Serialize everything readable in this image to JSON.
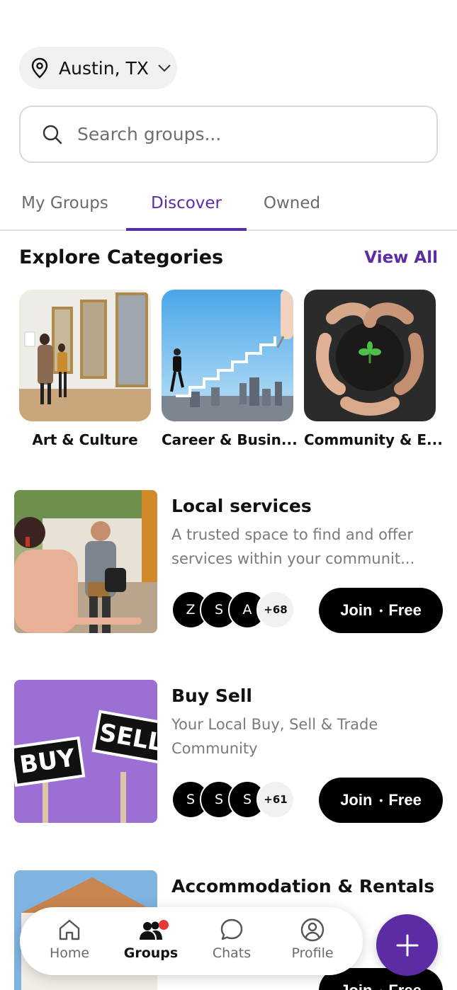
{
  "location": {
    "label": "Austin, TX",
    "icon": "map-pin-icon"
  },
  "search": {
    "placeholder": "Search groups..."
  },
  "tabs": [
    {
      "label": "My Groups",
      "active": false
    },
    {
      "label": "Discover",
      "active": true
    },
    {
      "label": "Owned",
      "active": false
    }
  ],
  "categories_section": {
    "title": "Explore Categories",
    "view_all": "View All",
    "items": [
      {
        "label": "Art & Culture"
      },
      {
        "label": "Career & Busin..."
      },
      {
        "label": "Community & E..."
      }
    ]
  },
  "groups": [
    {
      "title": "Local services",
      "description": "A trusted space to find and offer services within your communit...",
      "members": [
        "Z",
        "S",
        "A"
      ],
      "more": "+68",
      "join_label": "Join",
      "price": "Free"
    },
    {
      "title": "Buy Sell",
      "description": "Your Local Buy, Sell & Trade Community",
      "members": [
        "S",
        "S",
        "S"
      ],
      "more": "+61",
      "join_label": "Join",
      "price": "Free",
      "image_sign_texts": [
        "BUY",
        "SELL"
      ]
    },
    {
      "title": "Accommodation & Rentals",
      "description": "",
      "members": [],
      "more": "",
      "join_label": "Join",
      "price": "Free"
    }
  ],
  "bottom_nav": [
    {
      "label": "Home",
      "icon": "home-icon",
      "active": false
    },
    {
      "label": "Groups",
      "icon": "groups-icon",
      "active": true,
      "badge": true
    },
    {
      "label": "Chats",
      "icon": "chat-bubble-icon",
      "active": false
    },
    {
      "label": "Profile",
      "icon": "profile-icon",
      "active": false
    }
  ],
  "colors": {
    "accent": "#5b2ca3",
    "badge": "#e53935",
    "button": "#000000"
  }
}
